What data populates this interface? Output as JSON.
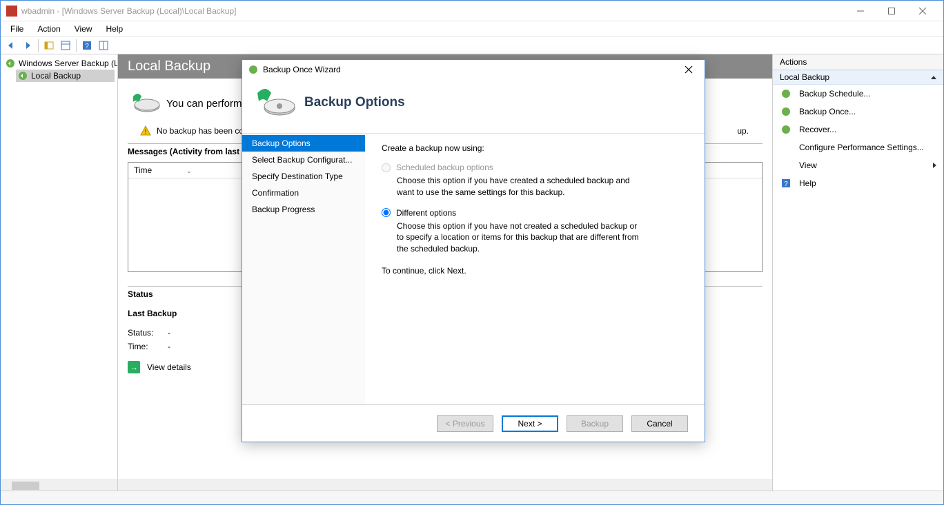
{
  "window": {
    "title": "wbadmin - [Windows Server Backup (Local)\\Local Backup]"
  },
  "menubar": [
    "File",
    "Action",
    "View",
    "Help"
  ],
  "tree": {
    "root": "Windows Server Backup (L",
    "child": "Local Backup"
  },
  "center": {
    "title": "Local Backup",
    "perform": "You can perform",
    "warn": "No backup has been co",
    "warn_suffix": "up.",
    "messages_header": "Messages (Activity from last w",
    "table_col_time": "Time",
    "status_header": "Status",
    "last_backup": "Last Backup",
    "status_label": "Status:",
    "status_value": "-",
    "time_label": "Time:",
    "time_value": "-",
    "view_details": "View details"
  },
  "actions": {
    "panel_title": "Actions",
    "section": "Local Backup",
    "items": [
      "Backup Schedule...",
      "Backup Once...",
      "Recover...",
      "Configure Performance Settings...",
      "View",
      "Help"
    ]
  },
  "dialog": {
    "window_title": "Backup Once Wizard",
    "page_title": "Backup Options",
    "nav": [
      "Backup Options",
      "Select Backup Configurat...",
      "Specify Destination Type",
      "Confirmation",
      "Backup Progress"
    ],
    "prompt": "Create a backup now using:",
    "opt1_label": "Scheduled backup options",
    "opt1_desc": "Choose this option if you have created a scheduled backup and want to use the same settings for this backup.",
    "opt2_label": "Different options",
    "opt2_desc": "Choose this option if you have not created a scheduled backup or to specify a location or items for this backup that are different from the scheduled backup.",
    "continue_hint": "To continue, click Next.",
    "btn_prev": "< Previous",
    "btn_next": "Next >",
    "btn_backup": "Backup",
    "btn_cancel": "Cancel"
  }
}
